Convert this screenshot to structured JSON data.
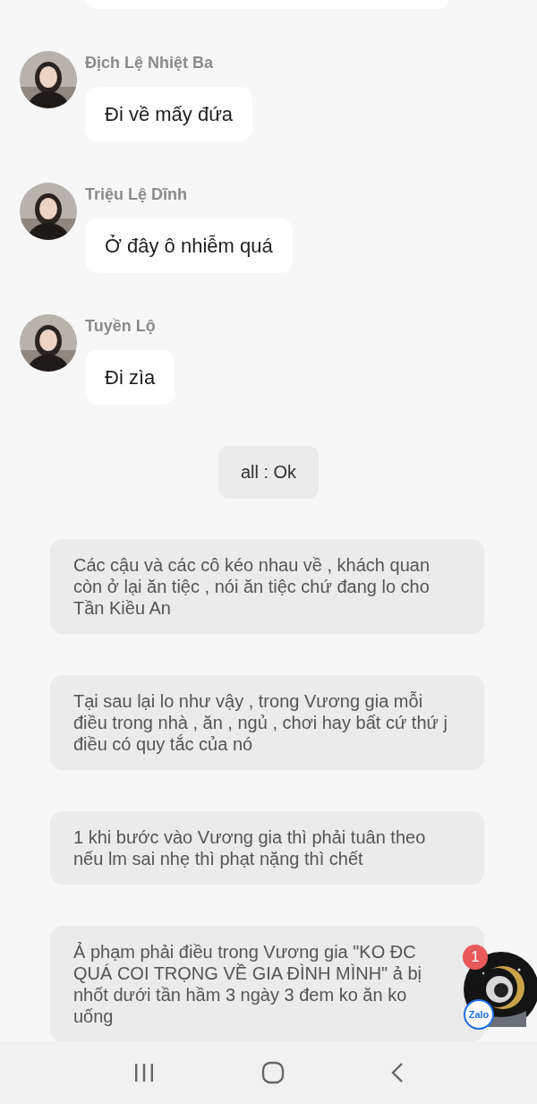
{
  "messages": [
    {
      "kind": "incoming",
      "sender": "Địch Lệ Nhiệt Ba",
      "text": "Đi về mấy đứa"
    },
    {
      "kind": "incoming",
      "sender": "Triệu Lệ Dĩnh",
      "text": "Ở đây ô nhiễm quá"
    },
    {
      "kind": "incoming",
      "sender": "Tuyền Lộ",
      "text": "Đi zìa"
    },
    {
      "kind": "system",
      "text": "all : Ok"
    },
    {
      "kind": "narration",
      "text": "Các cậu và các cô kéo nhau về , khách quan còn ở lại ăn tiệc , nói ăn tiệc chứ đang lo cho Tần Kiều An"
    },
    {
      "kind": "narration",
      "text": "Tại sau lại lo như vậy , trong Vương gia mỗi điều trong nhà , ăn , ngủ , chơi hay bất cứ thứ j điều có quy tắc của nó"
    },
    {
      "kind": "narration",
      "text": "1 khi bước vào Vương gia thì phải tuân theo nếu lm sai nhẹ thì phạt nặng thì chết"
    },
    {
      "kind": "narration",
      "text": "Ả phạm phải điều trong Vương gia \"KO ĐC QUÁ COI TRỌNG VỀ GIA ĐÌNH MÌNH\" ả bị nhốt dưới tần hầm 3 ngày 3 đem ko ăn ko uống"
    }
  ],
  "chat_head": {
    "badge": "1",
    "label": "Zalo"
  }
}
